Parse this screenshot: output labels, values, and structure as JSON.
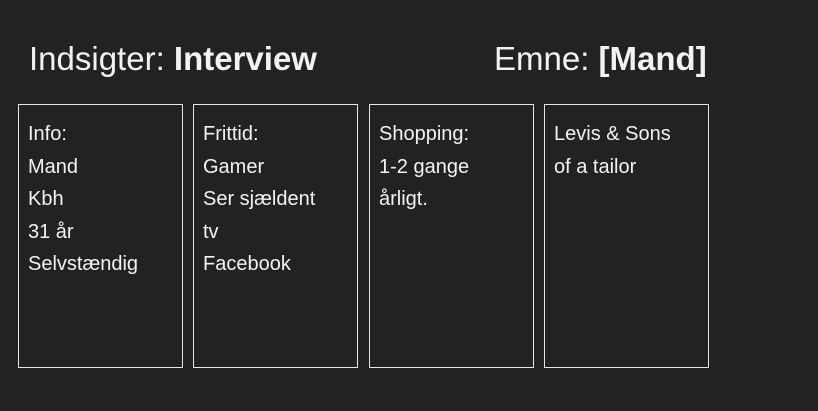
{
  "header": {
    "insights_label": "Indsigter:",
    "insights_value": "Interview",
    "subject_label": "Emne:",
    "subject_value": "[Mand]"
  },
  "cards": [
    {
      "lines": [
        "Info:",
        "Mand",
        "Kbh",
        "31 år",
        "Selvstændig"
      ]
    },
    {
      "lines": [
        "Frittid:",
        "Gamer",
        "Ser sjældent",
        "tv",
        "Facebook"
      ]
    },
    {
      "lines": [
        "Shopping:",
        "1-2 gange",
        "årligt."
      ]
    },
    {
      "lines": [
        "Levis & Sons",
        "of a tailor"
      ]
    }
  ]
}
